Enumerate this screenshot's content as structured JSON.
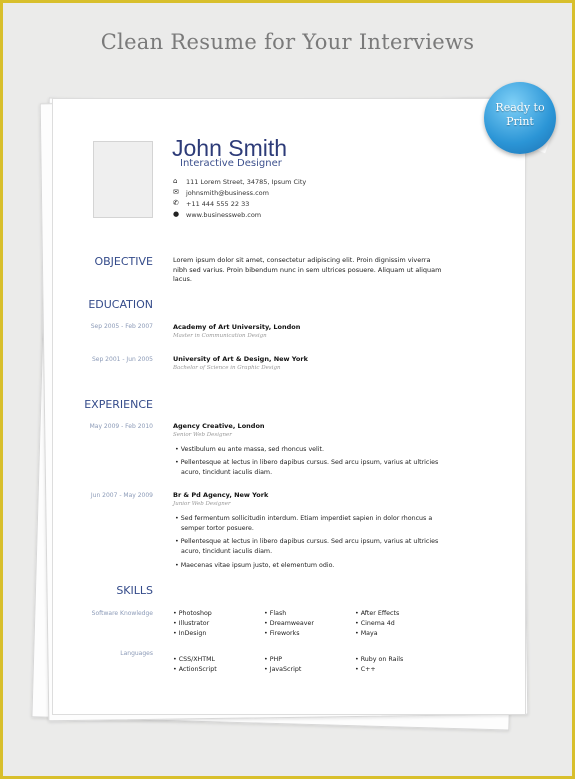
{
  "banner": {
    "title": "Clean Resume for Your Interviews",
    "badge_line1": "Ready to",
    "badge_line2": "Print"
  },
  "colors": {
    "accent": "#2d3b78",
    "frame": "#d8bf2c",
    "badge": "#2b95d6"
  },
  "header": {
    "name": "John Smith",
    "role": "Interactive Designer",
    "contacts": [
      {
        "icon": "home-icon",
        "glyph": "⌂",
        "text": "111 Lorem Street, 34785, Ipsum City"
      },
      {
        "icon": "mail-icon",
        "glyph": "✉",
        "text": "johnsmith@business.com"
      },
      {
        "icon": "phone-icon",
        "glyph": "✆",
        "text": "+11 444 555 22 33"
      },
      {
        "icon": "globe-icon",
        "glyph": "●",
        "text": "www.businessweb.com"
      }
    ]
  },
  "objective": {
    "heading": "OBJECTIVE",
    "text": "Lorem ipsum dolor sit amet, consectetur adipiscing elit. Proin dignissim viverra nibh sed varius. Proin bibendum nunc in sem ultrices posuere. Aliquam ut aliquam lacus."
  },
  "education": {
    "heading": "EDUCATION",
    "entries": [
      {
        "dates": "Sep 2005 - Feb 2007",
        "school": "Academy of Art University, London",
        "degree": "Master in Communication Design"
      },
      {
        "dates": "Sep 2001 - Jun 2005",
        "school": "University of Art & Design, New York",
        "degree": "Bachelor of Science in Graphic Design"
      }
    ]
  },
  "experience": {
    "heading": "EXPERIENCE",
    "entries": [
      {
        "dates": "May 2009 - Feb 2010",
        "company": "Agency Creative, London",
        "title": "Senior Web Designer",
        "bullets": [
          "Vestibulum eu ante massa, sed rhoncus velit.",
          "Pellentesque at lectus in libero dapibus cursus. Sed arcu ipsum, varius at ultricies acuro, tincidunt iaculis diam."
        ]
      },
      {
        "dates": "Jun 2007 - May 2009",
        "company": "Br & Pd Agency, New York",
        "title": "Junior Web Designer",
        "bullets": [
          "Sed fermentum sollicitudin interdum. Etiam imperdiet sapien in dolor rhoncus a semper tortor posuere.",
          "Pellentesque at lectus in libero dapibus cursus. Sed arcu ipsum, varius at ultricies acuro, tincidunt iaculis diam.",
          "Maecenas vitae ipsum justo, et elementum odio."
        ]
      }
    ]
  },
  "skills": {
    "heading": "SKILLS",
    "software_label": "Software Knowledge",
    "software": [
      "Photoshop",
      "Flash",
      "After Effects",
      "Illustrator",
      "Dreamweaver",
      "Cinema 4d",
      "InDesign",
      "Fireworks",
      "Maya"
    ],
    "languages_label": "Languages",
    "languages": [
      "CSS/XHTML",
      "PHP",
      "Ruby on Rails",
      "ActionScript",
      "JavaScript",
      "C++"
    ]
  }
}
